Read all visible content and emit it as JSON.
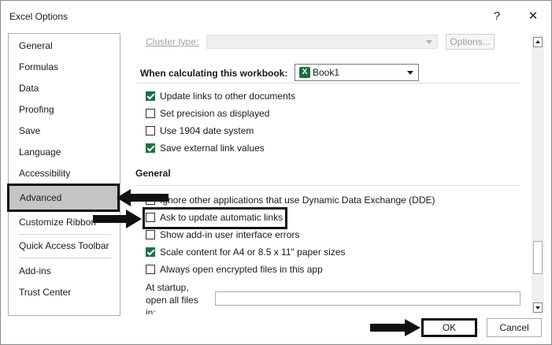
{
  "window": {
    "title": "Excel Options",
    "help": "?",
    "close": "✕"
  },
  "sidebar": {
    "items": [
      {
        "label": "General"
      },
      {
        "label": "Formulas"
      },
      {
        "label": "Data"
      },
      {
        "label": "Proofing"
      },
      {
        "label": "Save"
      },
      {
        "label": "Language"
      },
      {
        "label": "Accessibility"
      },
      {
        "label": "Advanced",
        "selected": true
      },
      {
        "label": "Customize Ribbon"
      },
      {
        "label": "Quick Access Toolbar"
      },
      {
        "label": "Add-ins"
      },
      {
        "label": "Trust Center"
      }
    ]
  },
  "content": {
    "cluster_label": "Cluster type:",
    "options_button": "Options...",
    "workbook_label": "When calculating this workbook:",
    "workbook_value": "Book1",
    "calc_options": [
      {
        "label": "Update links to other documents",
        "checked": true
      },
      {
        "label": "Set precision as displayed",
        "checked": false
      },
      {
        "label": "Use 1904 date system",
        "checked": false
      },
      {
        "label": "Save external link values",
        "checked": true
      }
    ],
    "general_heading": "General",
    "general_options": [
      {
        "label": "Ignore other applications that use Dynamic Data Exchange (DDE)",
        "checked": false
      },
      {
        "label": "Ask to update automatic links",
        "checked": false
      },
      {
        "label": "Show add-in user interface errors",
        "checked": false
      },
      {
        "label": "Scale content for A4 or 8.5 x 11\" paper sizes",
        "checked": true
      },
      {
        "label": "Always open encrypted files in this app",
        "checked": false
      }
    ],
    "startup_label_1": "At startup,",
    "startup_label_2": "open all files",
    "startup_label_3": "in:",
    "startup_value": ""
  },
  "footer": {
    "ok": "OK",
    "cancel": "Cancel"
  },
  "colors": {
    "checked": "#1f6f47",
    "selected_nav": "#c5c5c5",
    "excel_green": "#1d6f42"
  }
}
